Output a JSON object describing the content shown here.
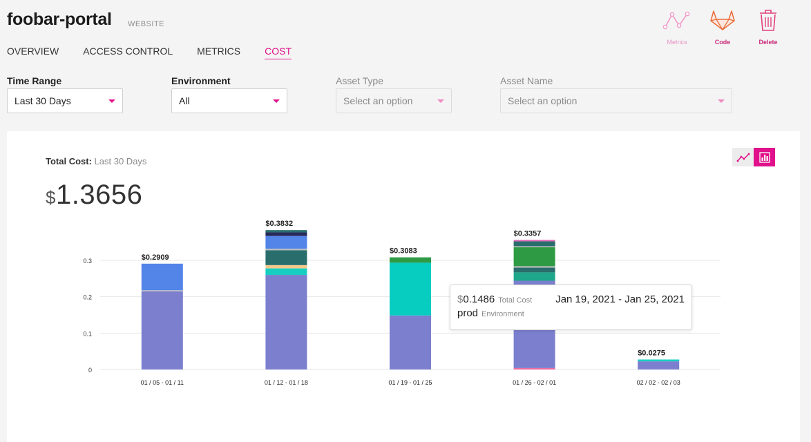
{
  "header": {
    "title": "foobar-portal",
    "type_badge": "WEBSITE"
  },
  "tabs": [
    {
      "label": "OVERVIEW",
      "active": false
    },
    {
      "label": "ACCESS CONTROL",
      "active": false
    },
    {
      "label": "METRICS",
      "active": false
    },
    {
      "label": "COST",
      "active": true
    }
  ],
  "actions": {
    "metrics": {
      "label": "Metrics",
      "icon": "metrics-icon"
    },
    "code": {
      "label": "Code",
      "icon": "gitlab-icon"
    },
    "delete": {
      "label": "Delete",
      "icon": "trash-icon"
    }
  },
  "filters": {
    "time_range": {
      "label": "Time Range",
      "value": "Last 30 Days"
    },
    "environment": {
      "label": "Environment",
      "value": "All"
    },
    "asset_type": {
      "label": "Asset Type",
      "placeholder": "Select an option"
    },
    "asset_name": {
      "label": "Asset Name",
      "placeholder": "Select an option"
    }
  },
  "cost_summary": {
    "label": "Total Cost:",
    "range": "Last 30 Days",
    "currency": "$",
    "value": "1.3656"
  },
  "chart_toggle": {
    "line_icon": "line-chart-icon",
    "bar_icon": "bar-chart-icon",
    "active": "bar"
  },
  "tooltip": {
    "currency": "$",
    "value": "0.1486",
    "value_label": "Total Cost",
    "range": "Jan 19, 2021 - Jan 25, 2021",
    "environment": "prod",
    "environment_label": "Environment"
  },
  "colors": {
    "accent": "#e0118a"
  },
  "chart_data": {
    "type": "bar",
    "stacked": true,
    "categories": [
      "01 / 05 - 01 / 11",
      "01 / 12 - 01 / 18",
      "01 / 19 - 01 / 25",
      "01 / 26 - 02 / 01",
      "02 / 02 - 02 / 03"
    ],
    "totals": [
      "$0.2909",
      "$0.3832",
      "$0.3083",
      "$0.3357",
      "$0.0275"
    ],
    "ylim": [
      0,
      0.3
    ],
    "yticks": [
      0,
      0.1,
      0.2,
      0.3
    ],
    "grid": true,
    "stacks": [
      [
        {
          "value": 0.215,
          "color": "#7b7fce"
        },
        {
          "value": 0.003,
          "color": "#bdbdbd"
        },
        {
          "value": 0.0729,
          "color": "#5385e9"
        }
      ],
      [
        {
          "value": 0.26,
          "color": "#7b7fce"
        },
        {
          "value": 0.018,
          "color": "#17cfc1"
        },
        {
          "value": 0.009,
          "color": "#f2c98a"
        },
        {
          "value": 0.041,
          "color": "#2a6d6d"
        },
        {
          "value": 0.004,
          "color": "#bdbdbd"
        },
        {
          "value": 0.035,
          "color": "#5385e9"
        },
        {
          "value": 0.01,
          "color": "#262a5a"
        },
        {
          "value": 0.0062,
          "color": "#2a6d6d"
        }
      ],
      [
        {
          "value": 0.1486,
          "color": "#7b7fce"
        },
        {
          "value": 0.145,
          "color": "#07cdc1"
        },
        {
          "value": 0.0147,
          "color": "#2f9a44"
        }
      ],
      [
        {
          "value": 0.004,
          "color": "#f06aa4"
        },
        {
          "value": 0.24,
          "color": "#7b7fce"
        },
        {
          "value": 0.023,
          "color": "#1ea78a"
        },
        {
          "value": 0.013,
          "color": "#2a6d6d"
        },
        {
          "value": 0.004,
          "color": "#bdbdbd"
        },
        {
          "value": 0.052,
          "color": "#2f9a44"
        },
        {
          "value": 0.003,
          "color": "#bdbdbd"
        },
        {
          "value": 0.0133,
          "color": "#2a6d6d"
        },
        {
          "value": 0.004,
          "color": "#e06ab6"
        }
      ],
      [
        {
          "value": 0.0225,
          "color": "#7b7fce"
        },
        {
          "value": 0.005,
          "color": "#17cfc1"
        }
      ]
    ]
  }
}
